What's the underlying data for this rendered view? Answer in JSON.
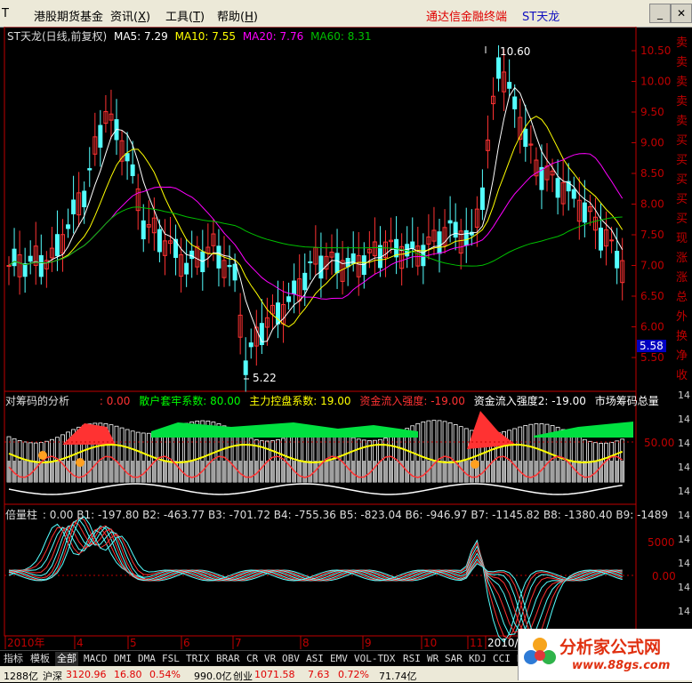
{
  "menu": {
    "items": [
      "港股期货基金",
      "资讯(X)",
      "工具(T)",
      "帮助(H)"
    ],
    "items_display": [
      "港股期货基金",
      "资讯",
      "工具",
      "帮助"
    ],
    "hotkeys": [
      "",
      "X",
      "T",
      "H"
    ],
    "app_title": "通达信金融终端",
    "stock_name": "ST天龙",
    "left_glyph": "T"
  },
  "main_panel": {
    "title": "ST天龙(日线,前复权)",
    "ma5": "MA5: 7.29",
    "ma10": "MA10: 7.55",
    "ma20": "MA20: 7.76",
    "ma60": "MA60: 8.31",
    "high_label": "10.60",
    "low_label": "5.22",
    "current_price_tag": "5.58",
    "y_ticks": [
      "10.50",
      "10.00",
      "9.50",
      "9.00",
      "8.50",
      "8.00",
      "7.50",
      "7.00",
      "6.50",
      "6.00",
      "5.50"
    ],
    "side_chars": [
      "卖",
      "卖",
      "卖",
      "卖",
      "卖",
      "买",
      "买",
      "买",
      "买",
      "买",
      "现",
      "涨",
      "涨",
      "总",
      "外",
      "换",
      "净",
      "收"
    ]
  },
  "chip_panel": {
    "title": "对筹码的分析",
    "v0": ": 0.00",
    "sanhu": "散户套牢系数: 80.00",
    "zhuli": "主力控盘系数: 19.00",
    "zijin1": "资金流入强度: -19.00",
    "zijin2": "资金流入强度2: -19.00",
    "total": "市场筹码总量",
    "y_tick": "50.00"
  },
  "bei_panel": {
    "title": "倍量柱",
    "values": ": 0.00  B1: -197.80  B2: -463.77  B3: -701.72  B4: -755.36  B5: -823.04  B6: -946.97  B7: -1145.82  B8: -1380.40  B9: -1489",
    "y_ticks": [
      "5000",
      "0.00",
      "-5000"
    ]
  },
  "x_axis": {
    "labels": [
      "2010年",
      "4",
      "5",
      "6",
      "7",
      "8",
      "9",
      "10",
      "11",
      "2010/"
    ]
  },
  "right_edge_chars": [
    "14",
    "14",
    "14",
    "14",
    "14",
    "14",
    "14",
    "14",
    "14",
    "14"
  ],
  "tabs": [
    "指标",
    "模板",
    "全部",
    "MACD",
    "DMI",
    "DMA",
    "FSL",
    "TRIX",
    "BRAR",
    "CR",
    "VR",
    "OBV",
    "ASI",
    "EMV",
    "VOL-TDX",
    "RSI",
    "WR",
    "SAR",
    "KDJ",
    "CCI",
    "RO"
  ],
  "status": {
    "left": "1288亿",
    "index_name": "沪深",
    "index_val": "3120.96",
    "chg": "16.80",
    "pct": "0.54%",
    "vol": "990.0亿",
    "idx2": "创业",
    "idx2_val": "1071.58",
    "chg2": "7.63",
    "pct2": "0.72%",
    "vol2": "71.74亿"
  },
  "watermark": {
    "title": "分析家公式网",
    "url": "www.88gs.com"
  },
  "colors": {
    "up": "#ff3232",
    "down": "#54ffff",
    "ma5": "#ffffff",
    "ma10": "#ffff00",
    "ma20": "#ff00ff",
    "ma60": "#00c000",
    "axis": "#c00000"
  }
}
